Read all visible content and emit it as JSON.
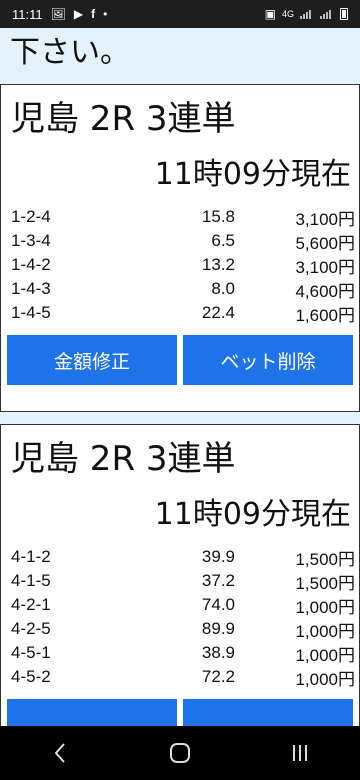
{
  "status": {
    "time": "11:11",
    "icons": [
      "image-icon",
      "play-icon",
      "facebook-icon",
      "dot-icon"
    ],
    "right_icons": [
      "battery-saver-icon",
      "4g-icon",
      "signal-icon",
      "signal-icon",
      "battery-icon"
    ],
    "net_label": "4G"
  },
  "top_text": "下さい。",
  "cards": [
    {
      "title": "児島 2R 3連単",
      "time": "11時09分現在",
      "rows": [
        {
          "combo": "1-2-4",
          "odds": "15.8",
          "amount": "3,100円"
        },
        {
          "combo": "1-3-4",
          "odds": "6.5",
          "amount": "5,600円"
        },
        {
          "combo": "1-4-2",
          "odds": "13.2",
          "amount": "3,100円"
        },
        {
          "combo": "1-4-3",
          "odds": "8.0",
          "amount": "4,600円"
        },
        {
          "combo": "1-4-5",
          "odds": "22.4",
          "amount": "1,600円"
        }
      ],
      "btn_edit": "金額修正",
      "btn_delete": "ベット削除"
    },
    {
      "title": "児島 2R 3連単",
      "time": "11時09分現在",
      "rows": [
        {
          "combo": "4-1-2",
          "odds": "39.9",
          "amount": "1,500円"
        },
        {
          "combo": "4-1-5",
          "odds": "37.2",
          "amount": "1,500円"
        },
        {
          "combo": "4-2-1",
          "odds": "74.0",
          "amount": "1,000円"
        },
        {
          "combo": "4-2-5",
          "odds": "89.9",
          "amount": "1,000円"
        },
        {
          "combo": "4-5-1",
          "odds": "38.9",
          "amount": "1,000円"
        },
        {
          "combo": "4-5-2",
          "odds": "72.2",
          "amount": "1,000円"
        }
      ],
      "btn_edit": "",
      "btn_delete": ""
    }
  ],
  "nav": {
    "icons": [
      "back-icon",
      "home-icon",
      "recents-icon"
    ]
  },
  "colors": {
    "page_bg": "#e3f2fd",
    "button": "#1e73e8",
    "status_bar": "#1e1e1e",
    "nav_bar": "#000000"
  }
}
